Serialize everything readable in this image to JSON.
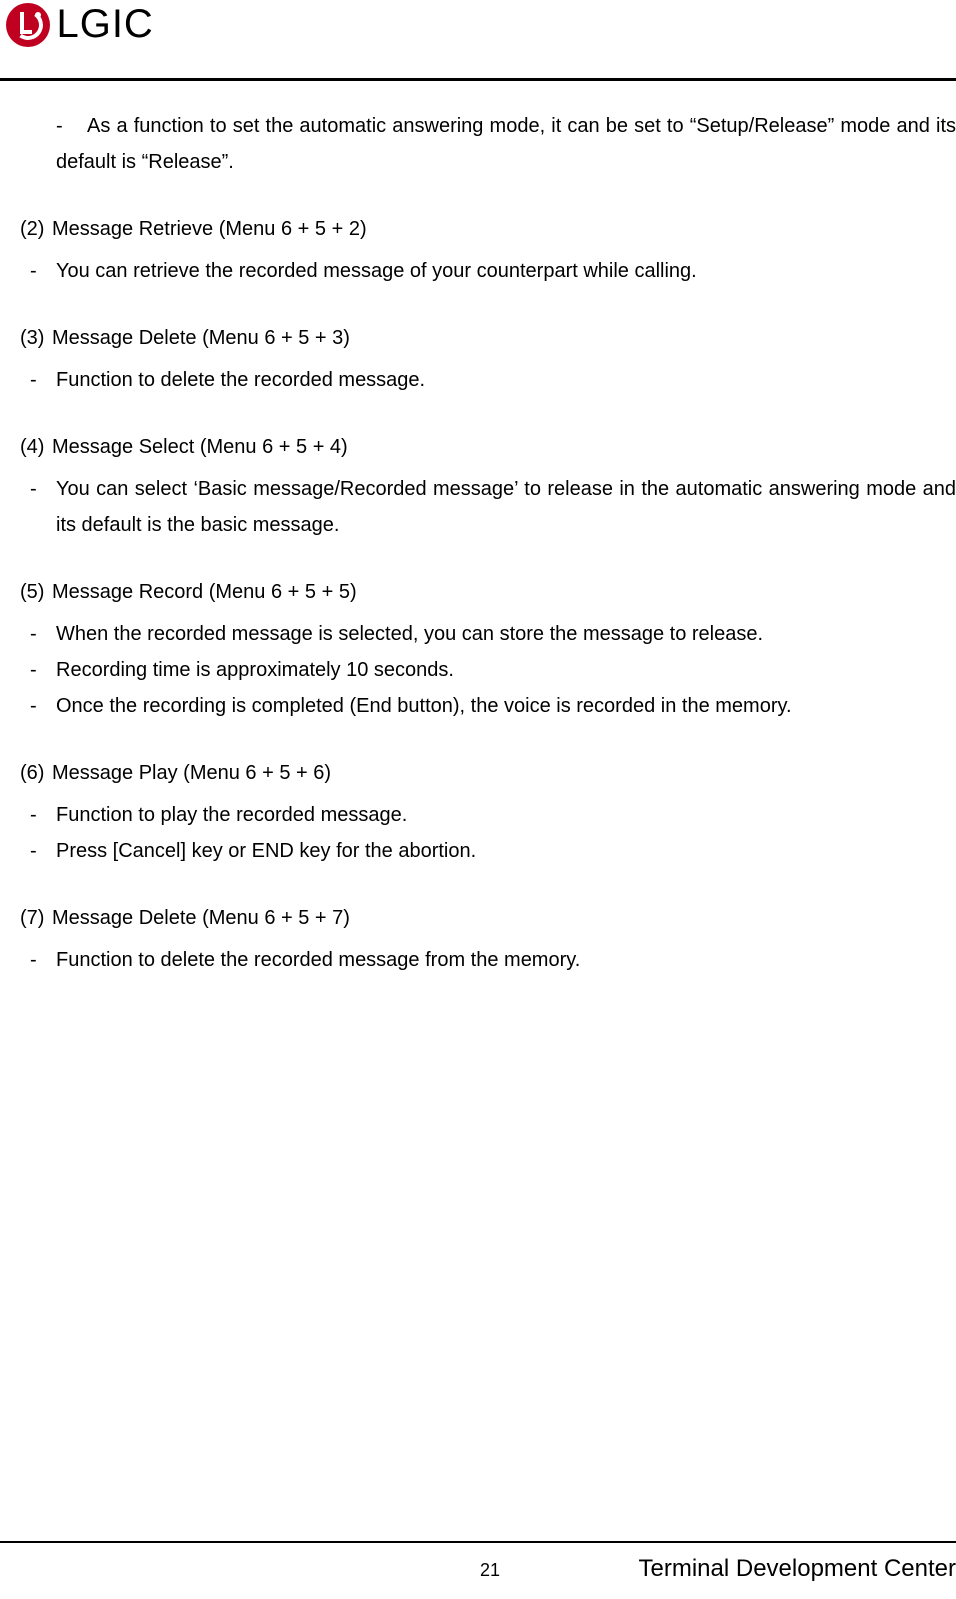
{
  "header": {
    "brand_text": "LGIC"
  },
  "orphan_bullet": {
    "text": "As a function to set the automatic answering mode, it can be set to “Setup/Release” mode and its default is “Release”."
  },
  "sections": [
    {
      "num": "(2)",
      "title": "Message Retrieve (Menu 6 + 5 + 2)",
      "bullets": [
        "You can retrieve the recorded message of your counterpart while calling."
      ]
    },
    {
      "num": "(3)",
      "title": "Message Delete (Menu 6 + 5 + 3)",
      "bullets": [
        "Function to delete the recorded message."
      ]
    },
    {
      "num": "(4)",
      "title": "Message Select (Menu 6 + 5 + 4)",
      "bullets": [
        "You can select ‘Basic message/Recorded message’ to release in the automatic answering mode and its default is the basic message."
      ]
    },
    {
      "num": "(5)",
      "title": "Message Record (Menu 6 + 5 + 5)",
      "bullets": [
        "When the recorded message is selected, you can store the message to release.",
        "Recording time is approximately 10 seconds.",
        "Once the recording is completed (End button), the voice is recorded in the memory."
      ]
    },
    {
      "num": "(6)",
      "title": "Message Play (Menu 6 + 5 + 6)",
      "bullets": [
        "Function to play the recorded message.",
        "Press [Cancel] key or END key for the abortion."
      ]
    },
    {
      "num": "(7)",
      "title": "Message Delete (Menu 6 + 5 + 7)",
      "bullets": [
        "Function to delete the recorded message from the memory."
      ]
    }
  ],
  "footer": {
    "page_number": "21",
    "right_text": "Terminal Development Center"
  }
}
